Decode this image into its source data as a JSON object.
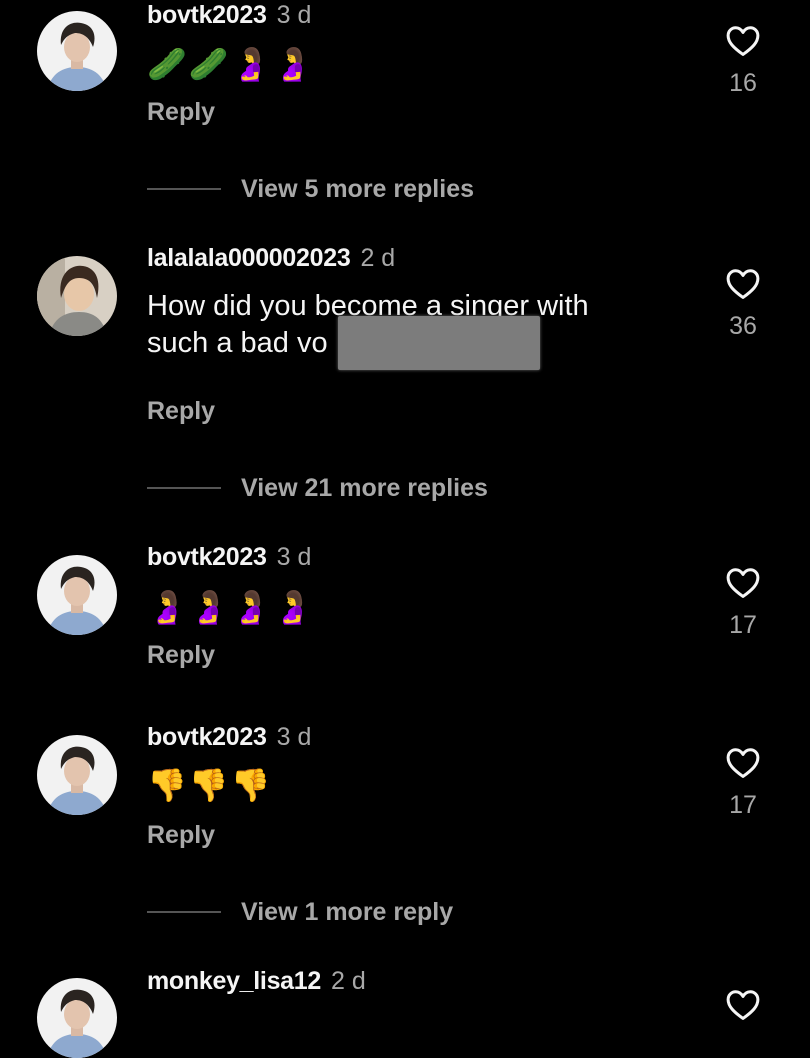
{
  "comments": [
    {
      "username": "bovtk2023",
      "time": "3 d",
      "emojis": "🥒🥒🤰🤰",
      "reply": "Reply",
      "likes": "16"
    },
    {
      "username": "lalalala000002023",
      "time": "2 d",
      "text_line1": "How did you become a singer with",
      "text_line2": "such a bad vo",
      "reply": "Reply",
      "likes": "36"
    },
    {
      "username": "bovtk2023",
      "time": "3 d",
      "emojis": "🤰🤰🤰🤰",
      "reply": "Reply",
      "likes": "17"
    },
    {
      "username": "bovtk2023",
      "time": "3 d",
      "emojis": "👎👎👎",
      "reply": "Reply",
      "likes": "17"
    },
    {
      "username": "monkey_lisa12",
      "time": "2 d"
    }
  ],
  "view_more": [
    "View 5 more replies",
    "View 21 more replies",
    "View 1 more reply"
  ],
  "colors": {
    "background": "#000000",
    "primary_text": "#f5f5f5",
    "secondary_text": "#a8a8a8",
    "redaction": "#7c7c7c"
  },
  "icons": {
    "like": "heart-outline-icon"
  }
}
